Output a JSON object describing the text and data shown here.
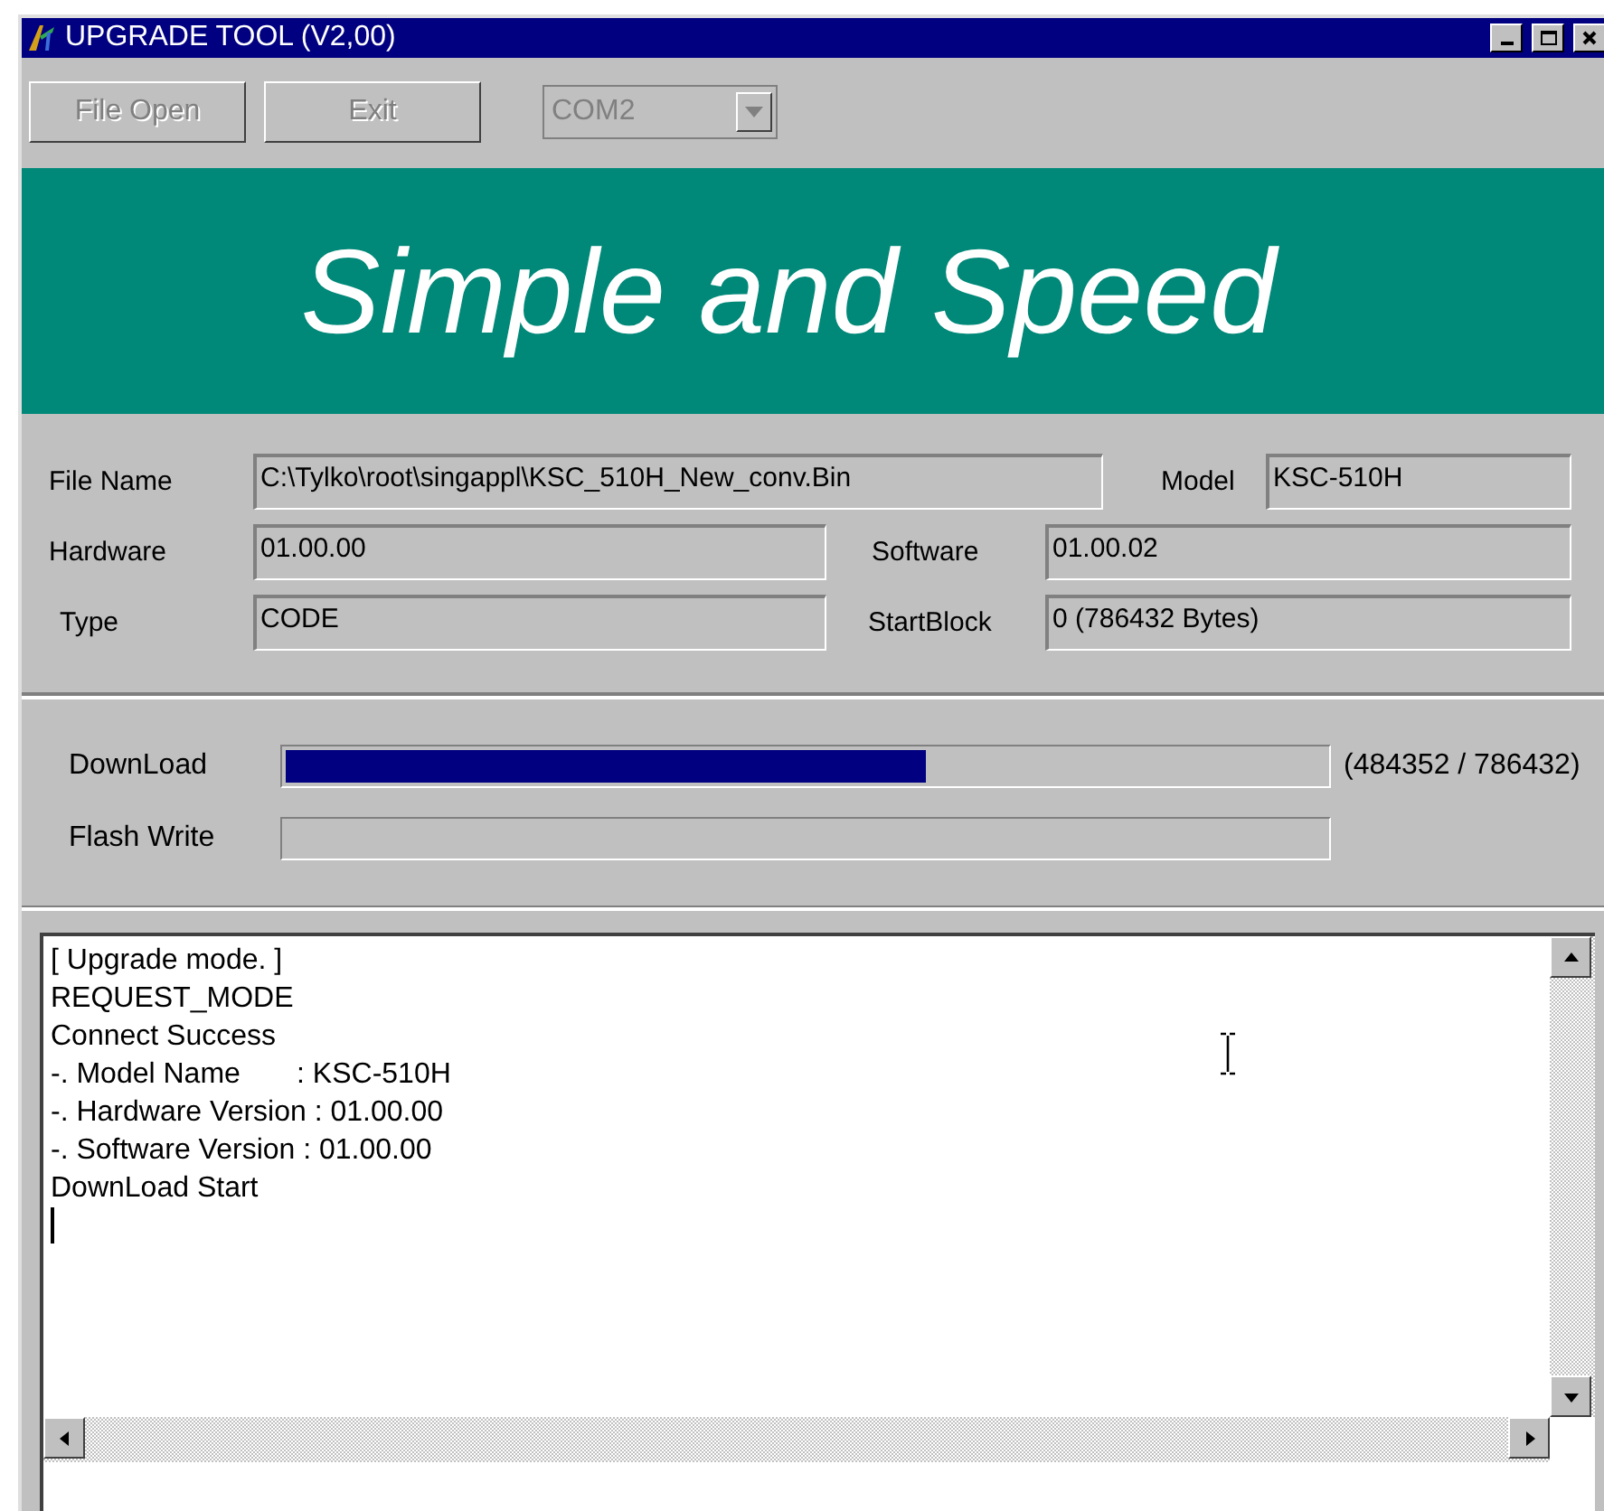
{
  "window": {
    "title": "UPGRADE TOOL (V2,00)"
  },
  "toolbar": {
    "buttons": [
      {
        "label": "File Open",
        "disabled": true
      },
      {
        "label": "Exit",
        "disabled": true
      }
    ],
    "port": {
      "value": "COM2",
      "disabled": true
    }
  },
  "banner": "Simple and Speed",
  "info": {
    "file_name": {
      "label": "File Name",
      "value": "C:\\Tylko\\root\\singappl\\KSC_510H_New_conv.Bin"
    },
    "model": {
      "label": "Model",
      "value": "KSC-510H"
    },
    "hardware": {
      "label": "Hardware",
      "value": "01.00.00"
    },
    "software": {
      "label": "Software",
      "value": "01.00.02"
    },
    "type": {
      "label": "Type",
      "value": "CODE"
    },
    "start_block": {
      "label": "StartBlock",
      "value": "0  (786432 Bytes)"
    }
  },
  "progress": [
    {
      "label": "DownLoad",
      "level": 0.616,
      "reading": "(484352 / 786432)"
    },
    {
      "label": "Flash Write",
      "level": 0
    }
  ],
  "log": [
    "[ Upgrade mode. ]",
    "REQUEST_MODE",
    "Connect Success",
    "-. Model Name       : KSC-510H",
    "-. Hardware Version : 01.00.00",
    "-. Software Version : 01.00.00",
    "DownLoad Start"
  ]
}
